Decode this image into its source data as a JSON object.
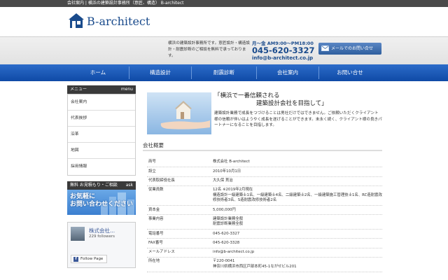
{
  "topbar": {
    "text": "会社案内 | 横浜の建築設計事務所（意匠、構造） B-architect"
  },
  "header": {
    "logo_text": "B-architect"
  },
  "subheader": {
    "tagline": "横浜の建築設計事務所です。意匠設計・構造設計・耐震診断のご相談を無料で承っております。",
    "hours": "月～金 AM9:00～PM18:00",
    "phone": "045-620-3327",
    "email": "info@b-architect.co.jp",
    "mail_button": "メールでのお問い合せ"
  },
  "nav": {
    "items": [
      "ホーム",
      "構造設計",
      "耐震診断",
      "会社案内",
      "お問い合せ"
    ]
  },
  "sidebar": {
    "menu_title": "メニュー",
    "menu_title_right": "menu",
    "items": [
      "会社案内",
      "代表挨拶",
      "沿革",
      "地図",
      "採用情報"
    ],
    "banner_head": "無料 お見積もり・ご相談",
    "banner_head_right": "ask",
    "banner_text_1": "お気軽に",
    "banner_text_2": "お問い合わせください",
    "fb_name": "株式会社...",
    "fb_followers": "229 followers",
    "fb_button": "Follow Page"
  },
  "main": {
    "hero_title_1": "「横浜で一番信頼される",
    "hero_title_2": "建築設計会社を目指して」",
    "hero_body": "建築設計業務で成長をつづけることは男社だけではできません。ご依頼いただくクライアント様の信頼が伴いはようやく成長を遂げることができます。末永く続く、クライアント様の良きパートナーになることを目指します。",
    "section_title": "会社概要",
    "rows": [
      {
        "k": "商号",
        "v": "株式会社 B-architect"
      },
      {
        "k": "設立",
        "v": "2010年10月1日"
      },
      {
        "k": "代表取締役社長",
        "v": "大久保 貫治"
      },
      {
        "k": "従業員数",
        "v": "12名 ※2019年2月現在\n構造設計一級建築士1名、一級建築士4名、二級建築士2名、一級建築施工管理技士1名、RC造耐震改修技術者3名、S造耐震改修技術者2名"
      },
      {
        "k": "資本金",
        "v": "5,000,000円"
      },
      {
        "k": "事業内容",
        "v": "建築設計業務全般\n耐震診断業務全般"
      },
      {
        "k": "電話番号",
        "v": "045-620-3327"
      },
      {
        "k": "FAX番号",
        "v": "045-620-3328"
      },
      {
        "k": "メールアドレス",
        "v": "info@b-architect.co.jp"
      },
      {
        "k": "所在地",
        "v": "〒220-0041\n神奈川県横浜市西区戸部本町45-1ながせビル201"
      }
    ]
  },
  "colors": {
    "nav": "#1a5bb8",
    "brand": "#1a4b8c",
    "dark": "#3a3a3a"
  }
}
